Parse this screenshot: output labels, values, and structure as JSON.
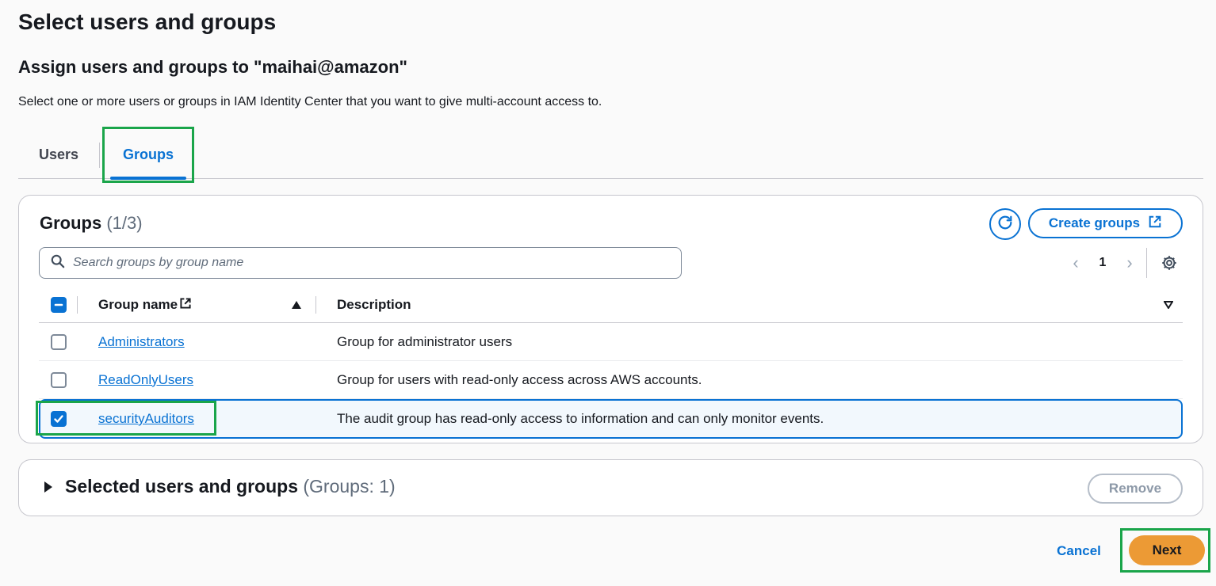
{
  "page": {
    "title": "Select users and groups",
    "section_title": "Assign users and groups to \"maihai@amazon\"",
    "section_desc": "Select one or more users or groups in IAM Identity Center that you want to give multi-account access to."
  },
  "tabs": [
    {
      "label": "Users",
      "active": false
    },
    {
      "label": "Groups",
      "active": true
    }
  ],
  "groups_panel": {
    "title": "Groups",
    "count": "(1/3)",
    "create_label": "Create groups",
    "search_placeholder": "Search groups by group name",
    "page_number": "1",
    "columns": {
      "name": "Group name",
      "description": "Description"
    },
    "rows": [
      {
        "name": "Administrators",
        "description": "Group for administrator users",
        "checked": false
      },
      {
        "name": "ReadOnlyUsers",
        "description": "Group for users with read-only access across AWS accounts.",
        "checked": false
      },
      {
        "name": "securityAuditors",
        "description": "The audit group has read-only access to information and can only monitor events.",
        "checked": true
      }
    ]
  },
  "selected_panel": {
    "title": "Selected users and groups",
    "count": "(Groups: 1)",
    "remove_label": "Remove"
  },
  "footer": {
    "cancel_label": "Cancel",
    "next_label": "Next"
  },
  "colors": {
    "accent": "#0972d3",
    "primary_button": "#ec9a35",
    "highlight": "#1aa54a"
  }
}
